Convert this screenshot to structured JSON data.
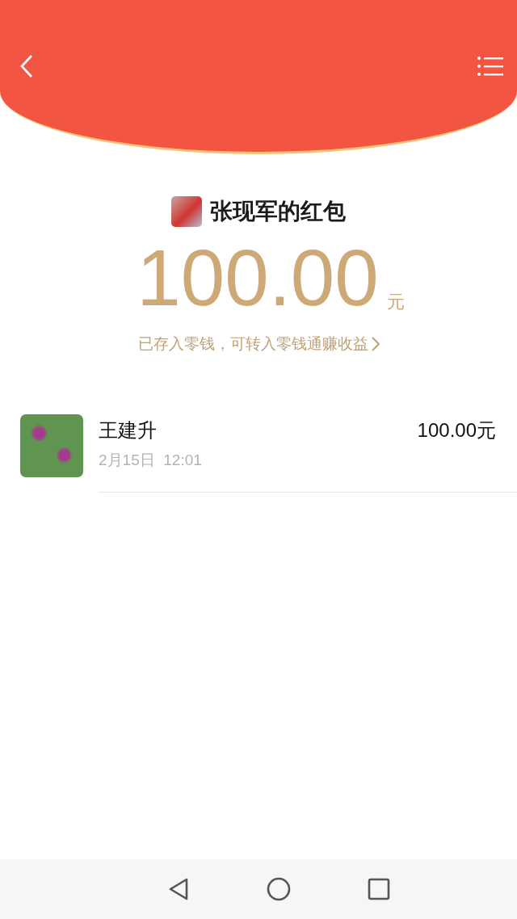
{
  "packet": {
    "title": "张现军的红包",
    "amount": "100.00",
    "unit": "元",
    "note": "已存入零钱，可转入零钱通赚收益"
  },
  "records": [
    {
      "name": "王建升",
      "time": "2月15日  12:01",
      "amount": "100.00元"
    }
  ]
}
